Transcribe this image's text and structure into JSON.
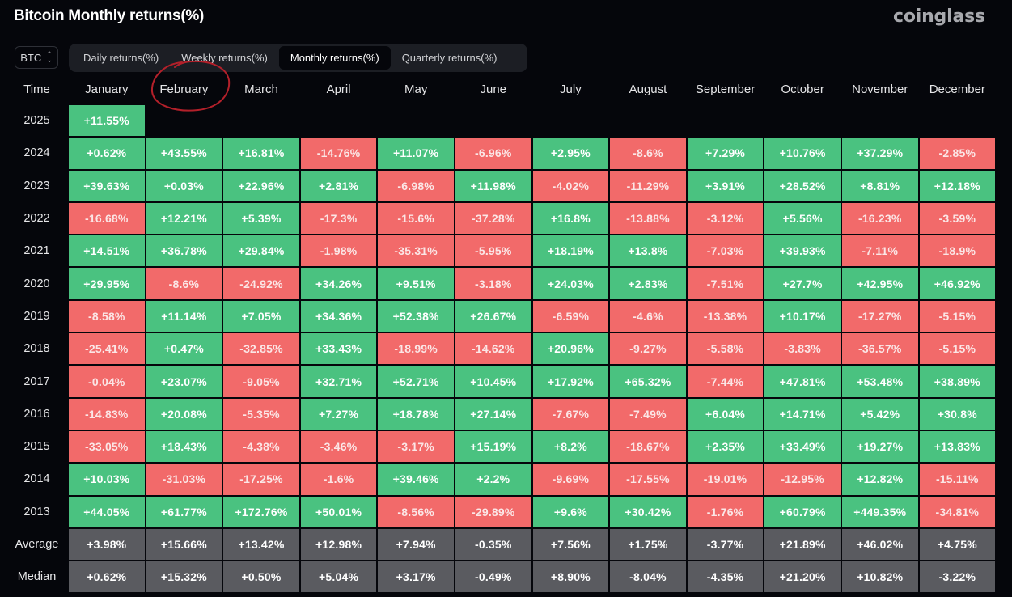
{
  "header": {
    "title": "Bitcoin Monthly returns(%)",
    "brand": "coinglass"
  },
  "asset_selector": {
    "value": "BTC",
    "icon": "up-down-chevron-icon"
  },
  "tabs": [
    {
      "label": "Daily returns(%)",
      "active": false
    },
    {
      "label": "Weekly returns(%)",
      "active": false
    },
    {
      "label": "Monthly returns(%)",
      "active": true
    },
    {
      "label": "Quarterly returns(%)",
      "active": false
    }
  ],
  "colors": {
    "positive": "#4ac280",
    "negative": "#f26a6a",
    "summary": "#5a5b60",
    "background": "#05060b",
    "annotation": "#b3202a"
  },
  "table": {
    "corner_label": "Time",
    "months": [
      "January",
      "February",
      "March",
      "April",
      "May",
      "June",
      "July",
      "August",
      "September",
      "October",
      "November",
      "December"
    ],
    "rows": [
      {
        "year": "2025",
        "values": [
          "+11.55%",
          "",
          "",
          "",
          "",
          "",
          "",
          "",
          "",
          "",
          "",
          ""
        ]
      },
      {
        "year": "2024",
        "values": [
          "+0.62%",
          "+43.55%",
          "+16.81%",
          "-14.76%",
          "+11.07%",
          "-6.96%",
          "+2.95%",
          "-8.6%",
          "+7.29%",
          "+10.76%",
          "+37.29%",
          "-2.85%"
        ]
      },
      {
        "year": "2023",
        "values": [
          "+39.63%",
          "+0.03%",
          "+22.96%",
          "+2.81%",
          "-6.98%",
          "+11.98%",
          "-4.02%",
          "-11.29%",
          "+3.91%",
          "+28.52%",
          "+8.81%",
          "+12.18%"
        ]
      },
      {
        "year": "2022",
        "values": [
          "-16.68%",
          "+12.21%",
          "+5.39%",
          "-17.3%",
          "-15.6%",
          "-37.28%",
          "+16.8%",
          "-13.88%",
          "-3.12%",
          "+5.56%",
          "-16.23%",
          "-3.59%"
        ]
      },
      {
        "year": "2021",
        "values": [
          "+14.51%",
          "+36.78%",
          "+29.84%",
          "-1.98%",
          "-35.31%",
          "-5.95%",
          "+18.19%",
          "+13.8%",
          "-7.03%",
          "+39.93%",
          "-7.11%",
          "-18.9%"
        ]
      },
      {
        "year": "2020",
        "values": [
          "+29.95%",
          "-8.6%",
          "-24.92%",
          "+34.26%",
          "+9.51%",
          "-3.18%",
          "+24.03%",
          "+2.83%",
          "-7.51%",
          "+27.7%",
          "+42.95%",
          "+46.92%"
        ]
      },
      {
        "year": "2019",
        "values": [
          "-8.58%",
          "+11.14%",
          "+7.05%",
          "+34.36%",
          "+52.38%",
          "+26.67%",
          "-6.59%",
          "-4.6%",
          "-13.38%",
          "+10.17%",
          "-17.27%",
          "-5.15%"
        ]
      },
      {
        "year": "2018",
        "values": [
          "-25.41%",
          "+0.47%",
          "-32.85%",
          "+33.43%",
          "-18.99%",
          "-14.62%",
          "+20.96%",
          "-9.27%",
          "-5.58%",
          "-3.83%",
          "-36.57%",
          "-5.15%"
        ]
      },
      {
        "year": "2017",
        "values": [
          "-0.04%",
          "+23.07%",
          "-9.05%",
          "+32.71%",
          "+52.71%",
          "+10.45%",
          "+17.92%",
          "+65.32%",
          "-7.44%",
          "+47.81%",
          "+53.48%",
          "+38.89%"
        ]
      },
      {
        "year": "2016",
        "values": [
          "-14.83%",
          "+20.08%",
          "-5.35%",
          "+7.27%",
          "+18.78%",
          "+27.14%",
          "-7.67%",
          "-7.49%",
          "+6.04%",
          "+14.71%",
          "+5.42%",
          "+30.8%"
        ]
      },
      {
        "year": "2015",
        "values": [
          "-33.05%",
          "+18.43%",
          "-4.38%",
          "-3.46%",
          "-3.17%",
          "+15.19%",
          "+8.2%",
          "-18.67%",
          "+2.35%",
          "+33.49%",
          "+19.27%",
          "+13.83%"
        ]
      },
      {
        "year": "2014",
        "values": [
          "+10.03%",
          "-31.03%",
          "-17.25%",
          "-1.6%",
          "+39.46%",
          "+2.2%",
          "-9.69%",
          "-17.55%",
          "-19.01%",
          "-12.95%",
          "+12.82%",
          "-15.11%"
        ]
      },
      {
        "year": "2013",
        "values": [
          "+44.05%",
          "+61.77%",
          "+172.76%",
          "+50.01%",
          "-8.56%",
          "-29.89%",
          "+9.6%",
          "+30.42%",
          "-1.76%",
          "+60.79%",
          "+449.35%",
          "-34.81%"
        ]
      }
    ],
    "summary_rows": [
      {
        "label": "Average",
        "values": [
          "+3.98%",
          "+15.66%",
          "+13.42%",
          "+12.98%",
          "+7.94%",
          "-0.35%",
          "+7.56%",
          "+1.75%",
          "-3.77%",
          "+21.89%",
          "+46.02%",
          "+4.75%"
        ]
      },
      {
        "label": "Median",
        "values": [
          "+0.62%",
          "+15.32%",
          "+0.50%",
          "+5.04%",
          "+3.17%",
          "-0.49%",
          "+8.90%",
          "-8.04%",
          "-4.35%",
          "+21.20%",
          "+10.82%",
          "-3.22%"
        ]
      }
    ]
  },
  "annotation": {
    "type": "hand-drawn-circle",
    "target": "February"
  }
}
